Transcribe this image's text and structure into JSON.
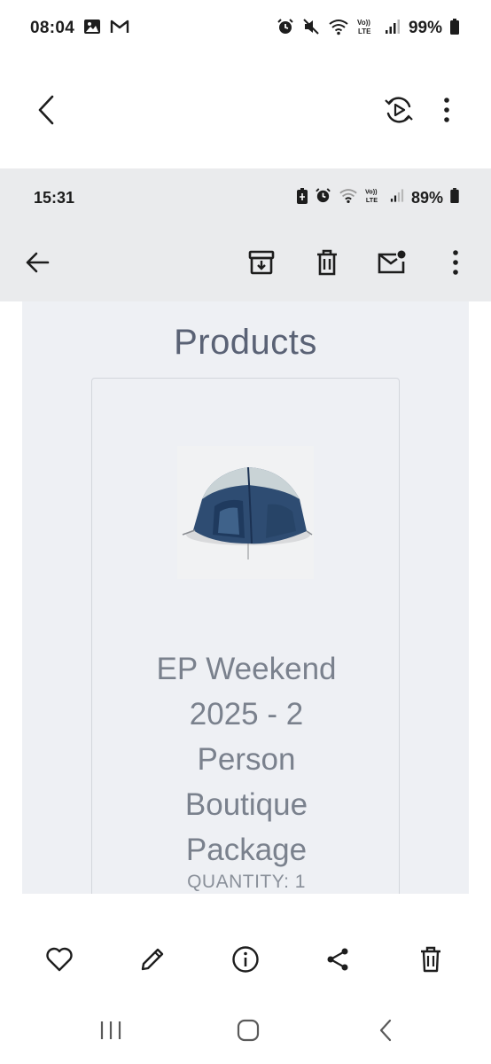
{
  "outer_status": {
    "time": "08:04",
    "battery": "99%",
    "icons": [
      "gallery-icon",
      "gmail-icon",
      "alarm-icon",
      "mute-icon",
      "wifi-icon",
      "volte-icon",
      "signal-icon",
      "battery-icon"
    ]
  },
  "gallery_toolbar": {
    "icons": [
      "back-arrow-icon",
      "rotate-play-icon",
      "more-vertical-icon"
    ]
  },
  "screenshot": {
    "status": {
      "time": "15:31",
      "battery": "89%"
    },
    "toolbar_icons": [
      "back-arrow-icon",
      "archive-icon",
      "delete-icon",
      "mark-unread-icon",
      "more-vertical-icon"
    ],
    "email": {
      "section_title": "Products",
      "product": {
        "name_lines": [
          "EP Weekend",
          "2025 - 2",
          "Person",
          "Boutique",
          "Package"
        ],
        "quantity": "QUANTITY: 1",
        "image": "tent-image"
      }
    }
  },
  "actions": {
    "icons": [
      "heart-icon",
      "edit-icon",
      "info-icon",
      "share-icon",
      "trash-icon"
    ]
  },
  "nav": {
    "icons": [
      "recent-apps-icon",
      "home-icon",
      "back-icon"
    ]
  },
  "colors": {
    "title_text": "#5a6275",
    "product_text": "#7a818d",
    "panel_bg": "#eef0f4",
    "inner_bar_bg": "#eaebed"
  }
}
